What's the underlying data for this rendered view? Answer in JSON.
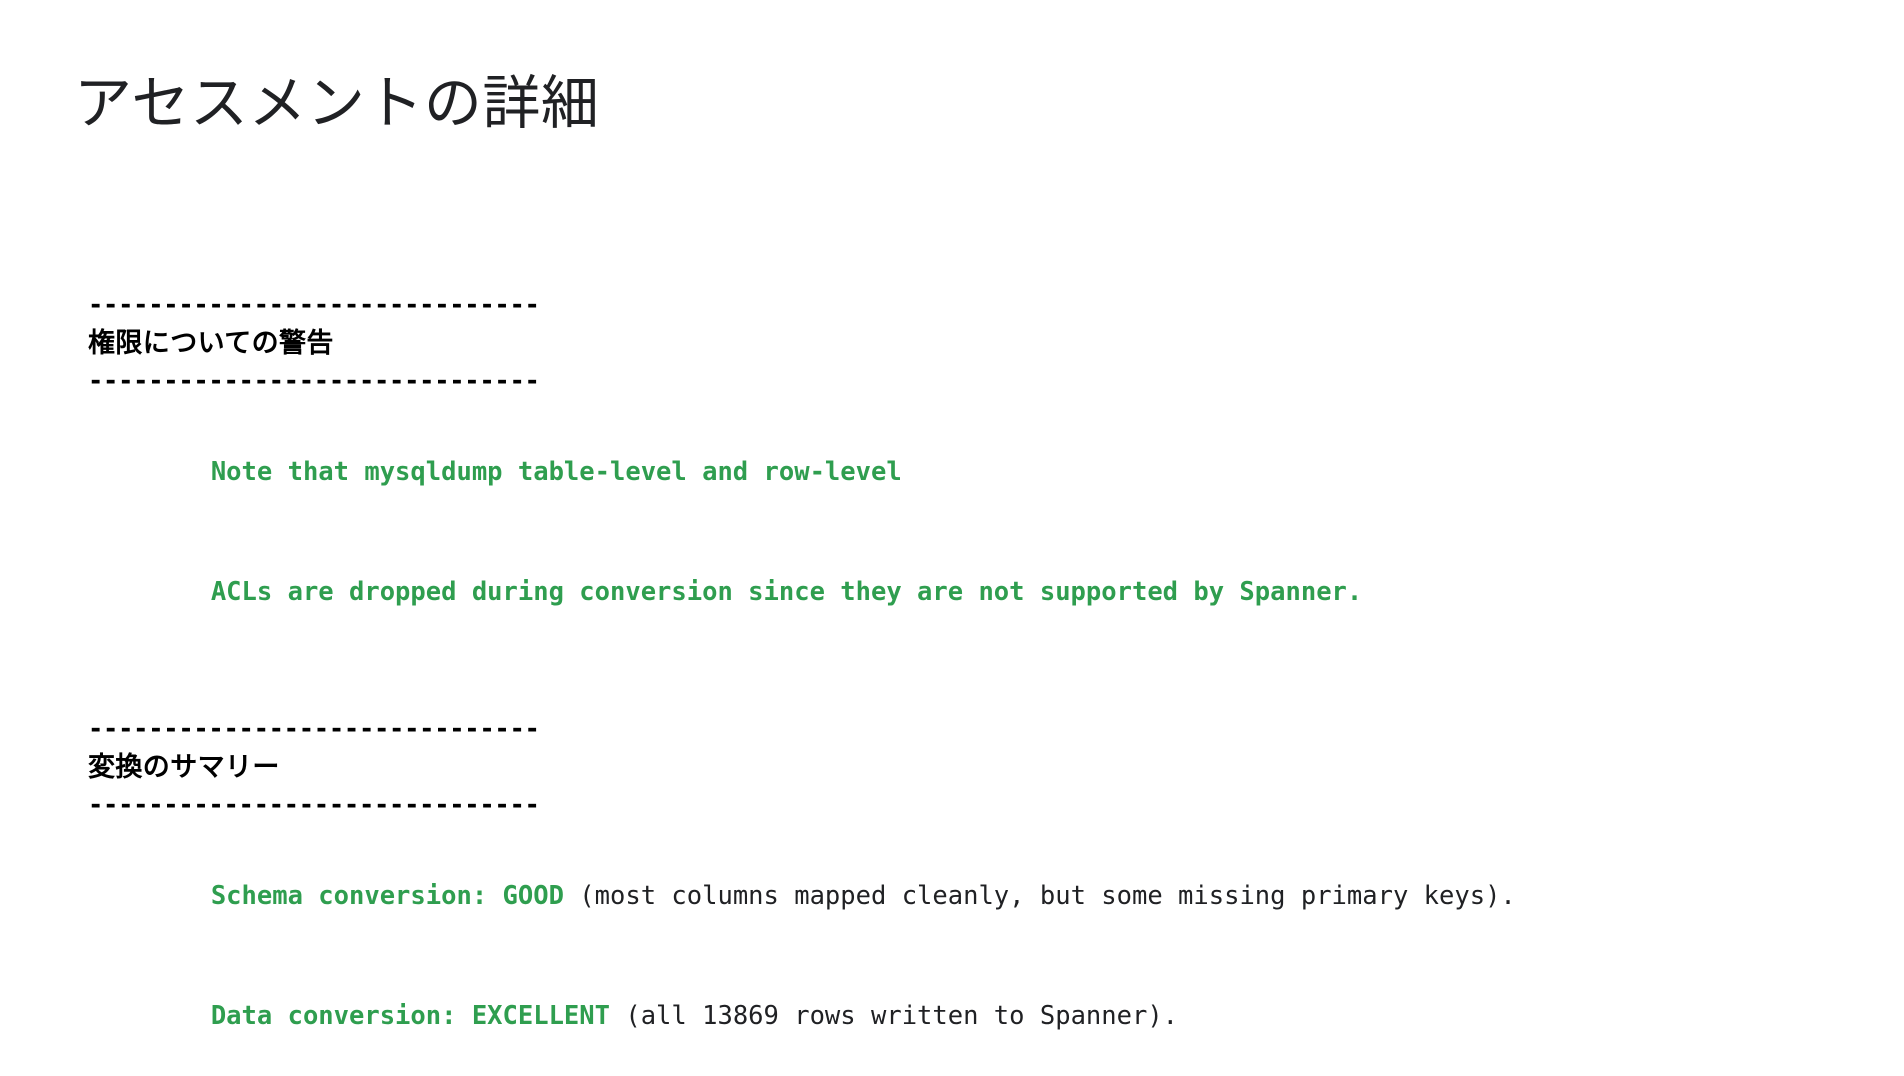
{
  "slide": {
    "title": "アセスメントの詳細",
    "background_color": "#ffffff",
    "title_color": "#202124"
  },
  "colors": {
    "green_accent": "#2f9e4f",
    "text_black": "#202124",
    "rule_black": "#000000"
  },
  "report": {
    "divider": "------------------------------",
    "sections": [
      {
        "heading": "権限についての警告",
        "lines": [
          {
            "green_text": "Note that mysqldump table-level and row-level",
            "plain_text": ""
          },
          {
            "green_text": "ACLs are dropped during conversion since they are not supported by Spanner.",
            "plain_text": ""
          }
        ]
      },
      {
        "heading": "変換のサマリー",
        "lines": [
          {
            "green_text": "Schema conversion: GOOD",
            "plain_text": " (most columns mapped cleanly, but some missing primary keys)."
          },
          {
            "green_text": "Data conversion: EXCELLENT",
            "plain_text": " (all 13869 rows written to Spanner)."
          }
        ]
      }
    ]
  }
}
